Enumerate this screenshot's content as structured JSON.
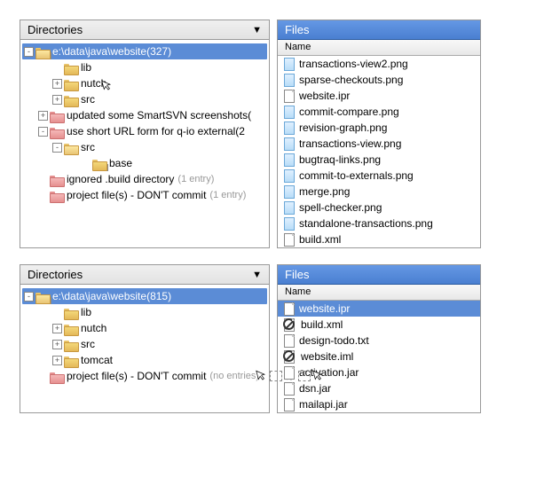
{
  "top": {
    "directories": {
      "title": "Directories",
      "items": [
        {
          "indent": 0,
          "expander": "-",
          "folder": "open-link",
          "text": "e:\\data\\java\\website",
          "count": "(327)",
          "selected": true
        },
        {
          "indent": 2,
          "expander": "",
          "folder": "closed",
          "text": "lib"
        },
        {
          "indent": 2,
          "expander": "+",
          "folder": "closed",
          "text": "nutch",
          "cursor": true
        },
        {
          "indent": 2,
          "expander": "+",
          "folder": "closed",
          "text": "src"
        },
        {
          "indent": 1,
          "expander": "+",
          "folder": "red",
          "text": "updated some SmartSVN screenshots",
          "count": "("
        },
        {
          "indent": 1,
          "expander": "-",
          "folder": "red",
          "text": "use short URL form for q-io external",
          "count": "(2"
        },
        {
          "indent": 2,
          "expander": "-",
          "folder": "open",
          "text": "src"
        },
        {
          "indent": 4,
          "expander": "",
          "folder": "closed-link",
          "text": "base"
        },
        {
          "indent": 1,
          "expander": "",
          "folder": "red",
          "text": "ignored .build directory",
          "dim": "(1 entry)"
        },
        {
          "indent": 1,
          "expander": "",
          "folder": "red",
          "text": "project file(s) - DON'T commit",
          "dim": "(1 entry)"
        }
      ]
    },
    "files": {
      "title": "Files",
      "col": "Name",
      "items": [
        {
          "icon": "png",
          "name": "transactions-view2.png"
        },
        {
          "icon": "png",
          "name": "sparse-checkouts.png"
        },
        {
          "icon": "ipr",
          "name": "website.ipr"
        },
        {
          "icon": "png",
          "name": "commit-compare.png"
        },
        {
          "icon": "png",
          "name": "revision-graph.png"
        },
        {
          "icon": "png",
          "name": "transactions-view.png"
        },
        {
          "icon": "png",
          "name": "bugtraq-links.png"
        },
        {
          "icon": "png",
          "name": "commit-to-externals.png"
        },
        {
          "icon": "png",
          "name": "merge.png"
        },
        {
          "icon": "png",
          "name": "spell-checker.png"
        },
        {
          "icon": "png",
          "name": "standalone-transactions.png"
        },
        {
          "icon": "xml",
          "name": "build.xml"
        }
      ]
    }
  },
  "bottom": {
    "directories": {
      "title": "Directories",
      "items": [
        {
          "indent": 0,
          "expander": "-",
          "folder": "open-link",
          "text": "e:\\data\\java\\website",
          "count": "(815)",
          "selected": true
        },
        {
          "indent": 2,
          "expander": "",
          "folder": "closed",
          "text": "lib"
        },
        {
          "indent": 2,
          "expander": "+",
          "folder": "closed",
          "text": "nutch"
        },
        {
          "indent": 2,
          "expander": "+",
          "folder": "closed",
          "text": "src"
        },
        {
          "indent": 2,
          "expander": "+",
          "folder": "closed",
          "text": "tomcat"
        },
        {
          "indent": 1,
          "expander": "",
          "folder": "red",
          "text": "project file(s) - DON'T commit",
          "dimpartial": "(no entries)",
          "multicursor": true
        }
      ]
    },
    "files": {
      "title": "Files",
      "col": "Name",
      "items": [
        {
          "icon": "ipr",
          "name": "website.ipr",
          "selected": true,
          "pink": true
        },
        {
          "icon": "xml-prohibit",
          "name": "build.xml"
        },
        {
          "icon": "txt",
          "name": "design-todo.txt"
        },
        {
          "icon": "iml-prohibit",
          "name": "website.iml"
        },
        {
          "icon": "jar",
          "name": "activation.jar"
        },
        {
          "icon": "jar",
          "name": "dsn.jar"
        },
        {
          "icon": "jar",
          "name": "mailapi.jar"
        }
      ]
    }
  }
}
